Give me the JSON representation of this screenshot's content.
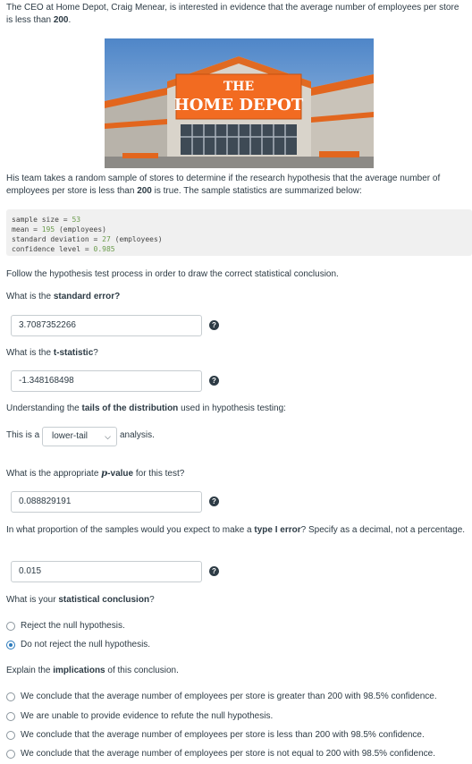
{
  "intro": {
    "text": "The CEO at Home Depot, Craig Menear, is interested in evidence that the average number of employees per store is less than ",
    "threshold": "200",
    "tail": "."
  },
  "photo": {
    "sign_line1": "THE",
    "sign_line2": "HOME DEPOT"
  },
  "team": {
    "text1": "His team takes a random sample of stores to determine if the research hypothesis that the average number of employees per store is less than ",
    "threshold": "200",
    "text2": " is true. The sample statistics are summarized below:"
  },
  "stats": [
    {
      "label": "sample size = ",
      "value": "53",
      "suffix": ""
    },
    {
      "label": "mean = ",
      "value": "195",
      "suffix": " (employees)"
    },
    {
      "label": "standard deviation = ",
      "value": "27",
      "suffix": " (employees)"
    },
    {
      "label": "confidence level = ",
      "value": "0.985",
      "suffix": ""
    }
  ],
  "instructions": "Follow the hypothesis test process in order to draw the correct statistical conclusion.",
  "q_se": {
    "pre": "What is the ",
    "bold": "standard error?",
    "post": "",
    "answer": "3.7087352266"
  },
  "q_t": {
    "pre": "What is the ",
    "bold": "t-statistic",
    "post": "?",
    "answer": "-1.348168498"
  },
  "tails": {
    "pre": "Understanding the ",
    "bold": "tails of the distribution",
    "post": " used in hypothesis testing:",
    "sentence_pre": "This is a",
    "selected": "lower-tail",
    "sentence_post": "analysis."
  },
  "q_p": {
    "pre": "What is the appropriate ",
    "p": "p",
    "bold": "-value",
    "post": " for this test?",
    "answer": "0.088829191"
  },
  "q_type1": {
    "pre": "In what proportion of the samples would you expect to make a ",
    "bold": "type I error",
    "post": "? Specify as a decimal, not a percentage.",
    "answer": "0.015"
  },
  "q_conclusion": {
    "pre": "What is your ",
    "bold": "statistical conclusion",
    "post": "?",
    "options": [
      "Reject the null hypothesis.",
      "Do not reject the null hypothesis."
    ],
    "selected_index": 1
  },
  "q_implications": {
    "pre": "Explain the ",
    "bold": "implications",
    "post": " of this conclusion.",
    "options": [
      "We conclude that the average number of employees per store is greater than 200 with 98.5% confidence.",
      "We are unable to provide evidence to refute the null hypothesis.",
      "We conclude that the average number of employees per store is less than 200 with 98.5% confidence.",
      "We conclude that the average number of employees per store is not equal to 200 with 98.5% confidence."
    ]
  },
  "help_glyph": "?",
  "icons": [
    "question-circle-icon",
    "chevron-down-icon"
  ]
}
